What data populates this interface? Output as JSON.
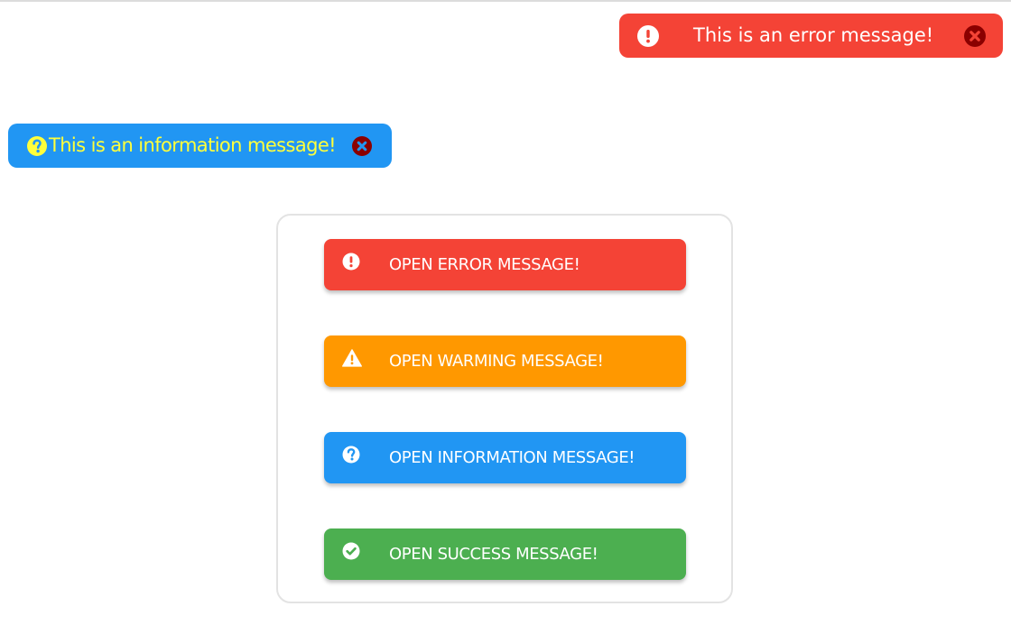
{
  "toasts": {
    "error": {
      "message": "This is an error message!",
      "icon": "exclamation-circle-icon",
      "close_icon": "close-circle-icon",
      "background": "#f44336",
      "text_color": "#ffffff"
    },
    "info": {
      "message": "This is an information message!",
      "icon": "question-circle-icon",
      "close_icon": "close-circle-icon",
      "background": "#2196f3",
      "text_color": "#ffff3b"
    }
  },
  "buttons": [
    {
      "label": "OPEN ERROR MESSAGE!",
      "icon": "exclamation-circle-icon",
      "color": "#f44336"
    },
    {
      "label": "OPEN WARMING MESSAGE!",
      "icon": "warning-triangle-icon",
      "color": "#ff9800"
    },
    {
      "label": "OPEN INFORMATION MESSAGE!",
      "icon": "question-circle-icon",
      "color": "#2196f3"
    },
    {
      "label": "OPEN SUCCESS MESSAGE!",
      "icon": "check-circle-icon",
      "color": "#4caf50"
    }
  ]
}
